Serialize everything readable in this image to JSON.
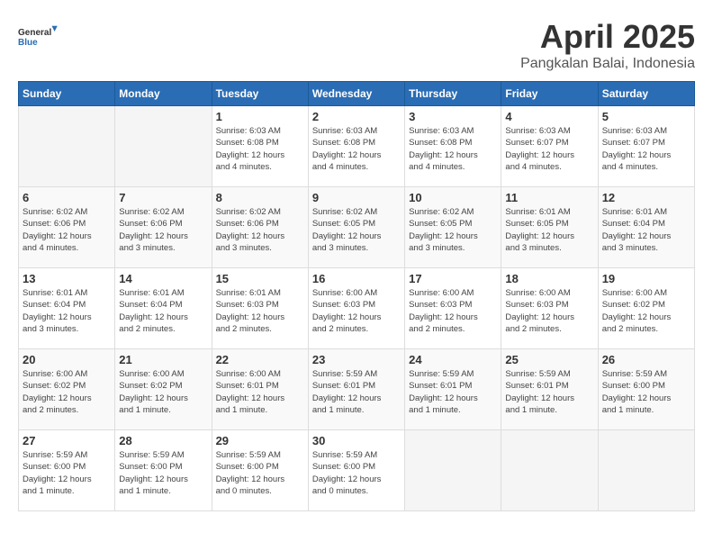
{
  "logo": {
    "general": "General",
    "blue": "Blue"
  },
  "title": "April 2025",
  "subtitle": "Pangkalan Balai, Indonesia",
  "days_header": [
    "Sunday",
    "Monday",
    "Tuesday",
    "Wednesday",
    "Thursday",
    "Friday",
    "Saturday"
  ],
  "weeks": [
    [
      {
        "num": "",
        "info": ""
      },
      {
        "num": "",
        "info": ""
      },
      {
        "num": "1",
        "info": "Sunrise: 6:03 AM\nSunset: 6:08 PM\nDaylight: 12 hours\nand 4 minutes."
      },
      {
        "num": "2",
        "info": "Sunrise: 6:03 AM\nSunset: 6:08 PM\nDaylight: 12 hours\nand 4 minutes."
      },
      {
        "num": "3",
        "info": "Sunrise: 6:03 AM\nSunset: 6:08 PM\nDaylight: 12 hours\nand 4 minutes."
      },
      {
        "num": "4",
        "info": "Sunrise: 6:03 AM\nSunset: 6:07 PM\nDaylight: 12 hours\nand 4 minutes."
      },
      {
        "num": "5",
        "info": "Sunrise: 6:03 AM\nSunset: 6:07 PM\nDaylight: 12 hours\nand 4 minutes."
      }
    ],
    [
      {
        "num": "6",
        "info": "Sunrise: 6:02 AM\nSunset: 6:06 PM\nDaylight: 12 hours\nand 4 minutes."
      },
      {
        "num": "7",
        "info": "Sunrise: 6:02 AM\nSunset: 6:06 PM\nDaylight: 12 hours\nand 3 minutes."
      },
      {
        "num": "8",
        "info": "Sunrise: 6:02 AM\nSunset: 6:06 PM\nDaylight: 12 hours\nand 3 minutes."
      },
      {
        "num": "9",
        "info": "Sunrise: 6:02 AM\nSunset: 6:05 PM\nDaylight: 12 hours\nand 3 minutes."
      },
      {
        "num": "10",
        "info": "Sunrise: 6:02 AM\nSunset: 6:05 PM\nDaylight: 12 hours\nand 3 minutes."
      },
      {
        "num": "11",
        "info": "Sunrise: 6:01 AM\nSunset: 6:05 PM\nDaylight: 12 hours\nand 3 minutes."
      },
      {
        "num": "12",
        "info": "Sunrise: 6:01 AM\nSunset: 6:04 PM\nDaylight: 12 hours\nand 3 minutes."
      }
    ],
    [
      {
        "num": "13",
        "info": "Sunrise: 6:01 AM\nSunset: 6:04 PM\nDaylight: 12 hours\nand 3 minutes."
      },
      {
        "num": "14",
        "info": "Sunrise: 6:01 AM\nSunset: 6:04 PM\nDaylight: 12 hours\nand 2 minutes."
      },
      {
        "num": "15",
        "info": "Sunrise: 6:01 AM\nSunset: 6:03 PM\nDaylight: 12 hours\nand 2 minutes."
      },
      {
        "num": "16",
        "info": "Sunrise: 6:00 AM\nSunset: 6:03 PM\nDaylight: 12 hours\nand 2 minutes."
      },
      {
        "num": "17",
        "info": "Sunrise: 6:00 AM\nSunset: 6:03 PM\nDaylight: 12 hours\nand 2 minutes."
      },
      {
        "num": "18",
        "info": "Sunrise: 6:00 AM\nSunset: 6:03 PM\nDaylight: 12 hours\nand 2 minutes."
      },
      {
        "num": "19",
        "info": "Sunrise: 6:00 AM\nSunset: 6:02 PM\nDaylight: 12 hours\nand 2 minutes."
      }
    ],
    [
      {
        "num": "20",
        "info": "Sunrise: 6:00 AM\nSunset: 6:02 PM\nDaylight: 12 hours\nand 2 minutes."
      },
      {
        "num": "21",
        "info": "Sunrise: 6:00 AM\nSunset: 6:02 PM\nDaylight: 12 hours\nand 1 minute."
      },
      {
        "num": "22",
        "info": "Sunrise: 6:00 AM\nSunset: 6:01 PM\nDaylight: 12 hours\nand 1 minute."
      },
      {
        "num": "23",
        "info": "Sunrise: 5:59 AM\nSunset: 6:01 PM\nDaylight: 12 hours\nand 1 minute."
      },
      {
        "num": "24",
        "info": "Sunrise: 5:59 AM\nSunset: 6:01 PM\nDaylight: 12 hours\nand 1 minute."
      },
      {
        "num": "25",
        "info": "Sunrise: 5:59 AM\nSunset: 6:01 PM\nDaylight: 12 hours\nand 1 minute."
      },
      {
        "num": "26",
        "info": "Sunrise: 5:59 AM\nSunset: 6:00 PM\nDaylight: 12 hours\nand 1 minute."
      }
    ],
    [
      {
        "num": "27",
        "info": "Sunrise: 5:59 AM\nSunset: 6:00 PM\nDaylight: 12 hours\nand 1 minute."
      },
      {
        "num": "28",
        "info": "Sunrise: 5:59 AM\nSunset: 6:00 PM\nDaylight: 12 hours\nand 1 minute."
      },
      {
        "num": "29",
        "info": "Sunrise: 5:59 AM\nSunset: 6:00 PM\nDaylight: 12 hours\nand 0 minutes."
      },
      {
        "num": "30",
        "info": "Sunrise: 5:59 AM\nSunset: 6:00 PM\nDaylight: 12 hours\nand 0 minutes."
      },
      {
        "num": "",
        "info": ""
      },
      {
        "num": "",
        "info": ""
      },
      {
        "num": "",
        "info": ""
      }
    ]
  ]
}
